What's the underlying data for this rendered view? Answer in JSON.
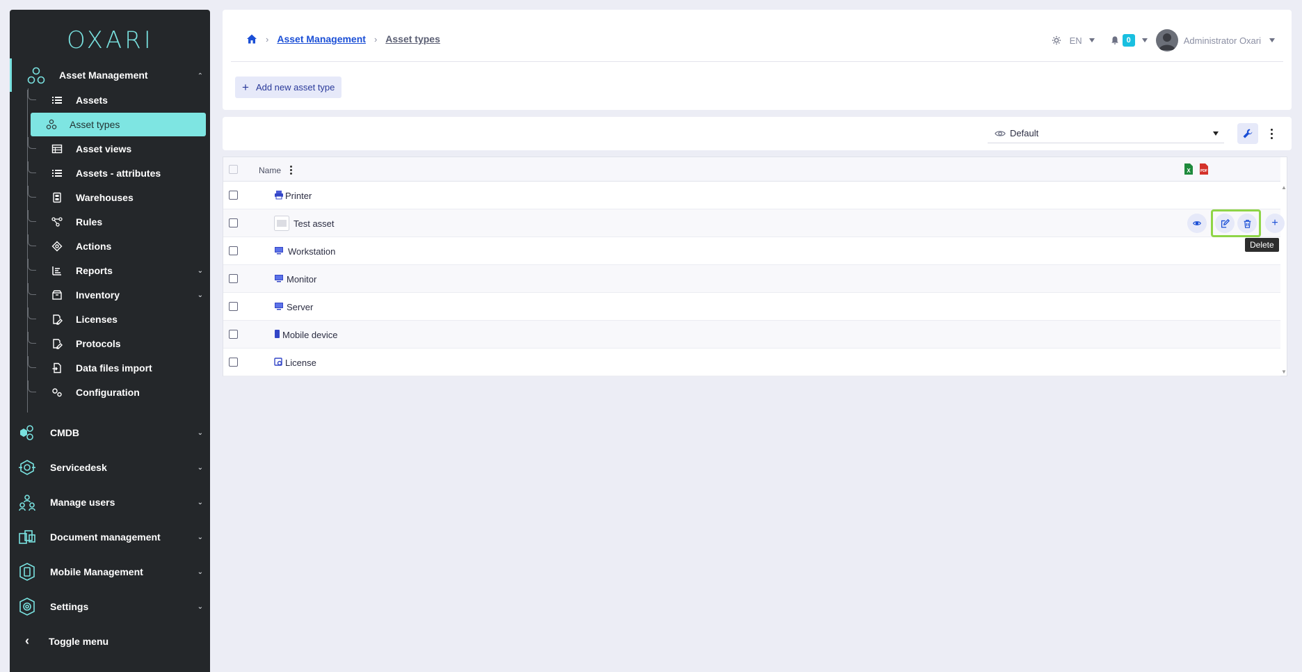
{
  "app": {
    "logo_text": "OXARI",
    "accent": "#79e2e0"
  },
  "sidebar": {
    "section": {
      "label": "Asset Management",
      "icon": "molecule-icon",
      "expanded": true
    },
    "sub_items": [
      {
        "label": "Assets",
        "icon": "list-icon"
      },
      {
        "label": "Asset types",
        "icon": "molecule-icon",
        "active": true
      },
      {
        "label": "Asset views",
        "icon": "table-icon"
      },
      {
        "label": "Assets - attributes",
        "icon": "list-icon"
      },
      {
        "label": "Warehouses",
        "icon": "building-icon"
      },
      {
        "label": "Rules",
        "icon": "flow-icon"
      },
      {
        "label": "Actions",
        "icon": "target-icon"
      },
      {
        "label": "Reports",
        "icon": "chart-icon",
        "has_children": true
      },
      {
        "label": "Inventory",
        "icon": "box-icon",
        "has_children": true
      },
      {
        "label": "Licenses",
        "icon": "doc-edit-icon"
      },
      {
        "label": "Protocols",
        "icon": "doc-edit-icon"
      },
      {
        "label": "Data files import",
        "icon": "file-import-icon"
      },
      {
        "label": "Configuration",
        "icon": "gears-icon"
      }
    ],
    "main_items": [
      {
        "label": "CMDB",
        "icon": "cmdb-icon"
      },
      {
        "label": "Servicedesk",
        "icon": "servicedesk-icon"
      },
      {
        "label": "Manage users",
        "icon": "users-icon"
      },
      {
        "label": "Document management",
        "icon": "documents-icon"
      },
      {
        "label": "Mobile Management",
        "icon": "mobile-icon"
      },
      {
        "label": "Settings",
        "icon": "settings-icon"
      }
    ],
    "toggle_label": "Toggle menu"
  },
  "header": {
    "breadcrumb": [
      "Asset Management",
      "Asset types"
    ],
    "lang": "EN",
    "notifications": "0",
    "username": "Administrator Oxari"
  },
  "actions": {
    "add_label": "Add new asset type"
  },
  "toolbar": {
    "view_label": "Default"
  },
  "table": {
    "column_name": "Name",
    "rows": [
      {
        "label": "Printer",
        "icon": "printer-icon"
      },
      {
        "label": "Test asset",
        "icon": "image-placeholder-icon"
      },
      {
        "label": "Workstation",
        "icon": "computer-icon"
      },
      {
        "label": "Monitor",
        "icon": "computer-icon"
      },
      {
        "label": "Server",
        "icon": "computer-icon"
      },
      {
        "label": "Mobile device",
        "icon": "mobile-icon"
      },
      {
        "label": "License",
        "icon": "license-icon"
      }
    ],
    "tooltip": "Delete"
  }
}
